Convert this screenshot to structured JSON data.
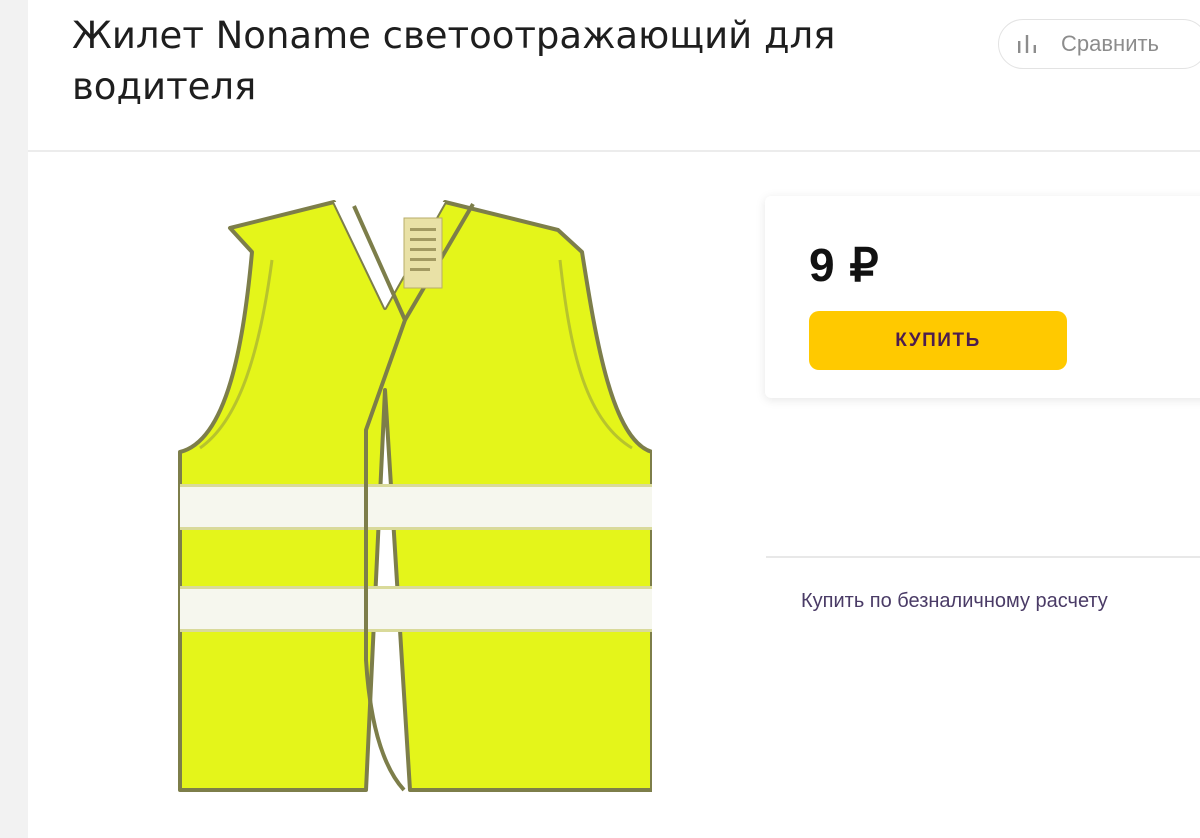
{
  "product": {
    "title": "Жилет Noname светоотражающий для водителя",
    "image_alt": "Светоотражающий жилет",
    "image_icon": "safety-vest-image"
  },
  "header": {
    "compare_label": "Сравнить",
    "compare_icon": "bar-chart-icon"
  },
  "offer": {
    "price": "9 ₽",
    "buy_label": "КУПИТЬ",
    "cashless_label": "Купить по безналичному расчету"
  },
  "colors": {
    "accent": "#ffc900",
    "buy_text": "#4c1d4e",
    "vest": "#e4f51a",
    "link": "#4a3b66"
  }
}
